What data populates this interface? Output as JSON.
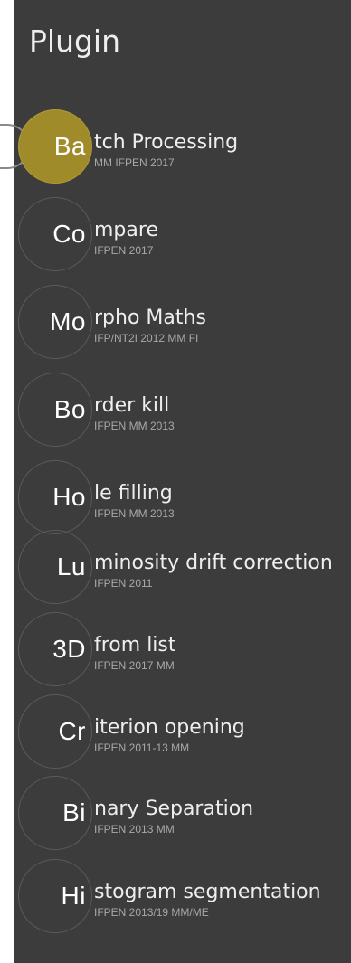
{
  "panel": {
    "title": "Plugin",
    "accent": "#a08b2a",
    "background": "#3c3c3c"
  },
  "plugins": [
    {
      "abbr": "Ba",
      "name": "tch Processing",
      "sub": "MM IFPEN 2017",
      "active": true
    },
    {
      "abbr": "Co",
      "name": "mpare",
      "sub": "IFPEN 2017"
    },
    {
      "abbr": "Mo",
      "name": "rpho Maths",
      "sub": "IFP/NT2I 2012 MM FI"
    },
    {
      "abbr": "Bo",
      "name": "rder kill",
      "sub": "IFPEN MM 2013"
    },
    {
      "abbr": "Ho",
      "name": "le filling",
      "sub": "IFPEN MM 2013"
    },
    {
      "abbr": "Lu",
      "name": "minosity drift correction",
      "sub": "IFPEN 2011"
    },
    {
      "abbr": "3D",
      "name": "from list",
      "sub": "IFPEN 2017 MM"
    },
    {
      "abbr": "Cr",
      "name": "iterion opening",
      "sub": "IFPEN 2011-13 MM"
    },
    {
      "abbr": "Bi",
      "name": "nary Separation",
      "sub": "IFPEN 2013 MM"
    },
    {
      "abbr": "Hi",
      "name": "stogram segmentation",
      "sub": "IFPEN 2013/19 MM/ME"
    }
  ]
}
